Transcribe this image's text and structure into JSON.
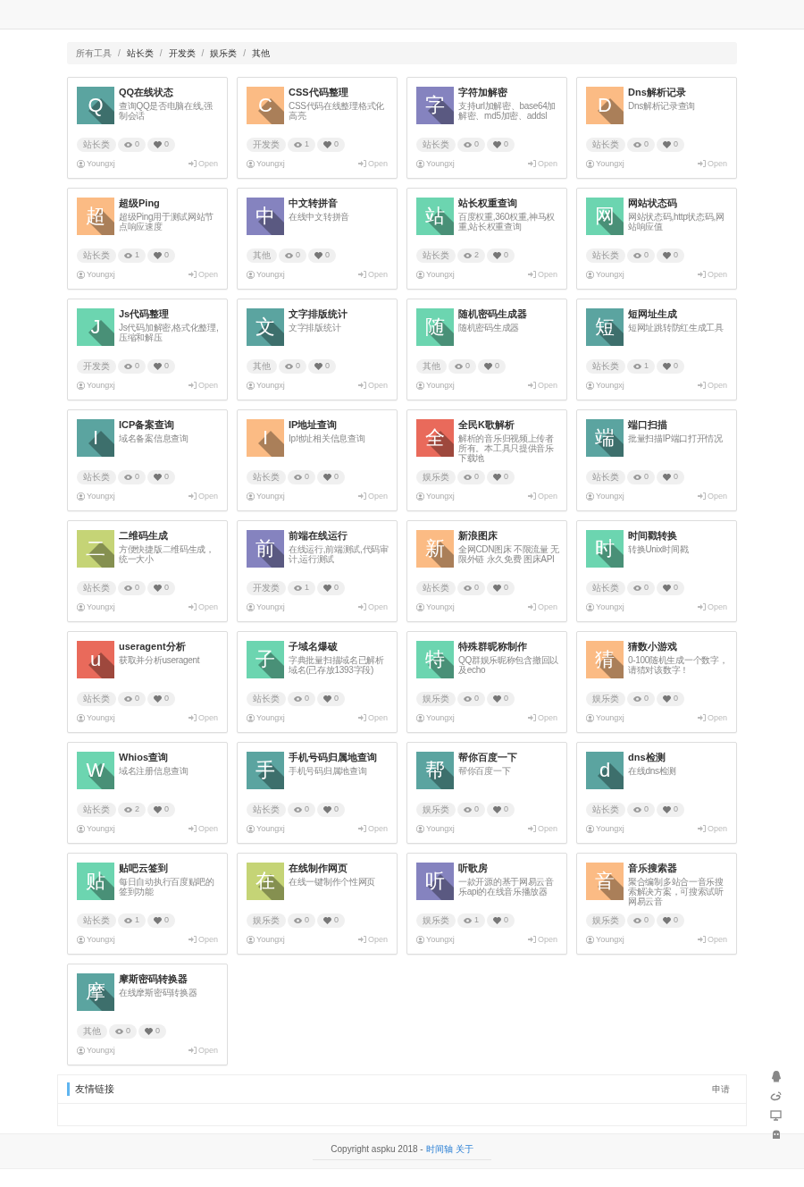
{
  "breadcrumb": [
    {
      "label": "所有工具",
      "selected": true
    },
    {
      "separator": "/",
      "label": "站长类",
      "selected": false
    },
    {
      "separator": "/",
      "label": "开发类",
      "selected": false
    },
    {
      "separator": "/",
      "label": "娱乐类",
      "selected": false
    },
    {
      "separator": "/",
      "label": "其他",
      "selected": false
    }
  ],
  "tools": [
    {
      "letter": "Q",
      "color": "#5ba4a0",
      "title": "QQ在线状态",
      "description": "查询QQ是否电脑在线,强制会话",
      "category": "站长类",
      "views": "0",
      "likes": "0",
      "author": "Youngxj",
      "action": "Open"
    },
    {
      "letter": "C",
      "color": "#fbbb84",
      "title": "CSS代码整理",
      "description": "CSS代码在线整理格式化高亮",
      "category": "开发类",
      "views": "1",
      "likes": "0",
      "author": "Youngxj",
      "action": "Open"
    },
    {
      "letter": "字",
      "color": "#8583bf",
      "title": "字符加解密",
      "description": "支持url加解密、base64加解密、md5加密、addsl",
      "category": "站长类",
      "views": "0",
      "likes": "0",
      "author": "Youngxj",
      "action": "Open"
    },
    {
      "letter": "D",
      "color": "#fbbb84",
      "title": "Dns解析记录",
      "description": "Dns解析记录查询",
      "category": "站长类",
      "views": "0",
      "likes": "0",
      "author": "Youngxj",
      "action": "Open"
    },
    {
      "letter": "超",
      "color": "#fbbb84",
      "title": "超级Ping",
      "description": "超级Ping用于测试网站节点响应速度",
      "category": "站长类",
      "views": "1",
      "likes": "0",
      "author": "Youngxj",
      "action": "Open"
    },
    {
      "letter": "中",
      "color": "#8583bf",
      "title": "中文转拼音",
      "description": "在线中文转拼音",
      "category": "其他",
      "views": "0",
      "likes": "0",
      "author": "Youngxj",
      "action": "Open"
    },
    {
      "letter": "站",
      "color": "#6cd5b0",
      "title": "站长权重查询",
      "description": "百度权重,360权重,神马权重,站长权重查询",
      "category": "站长类",
      "views": "2",
      "likes": "0",
      "author": "Youngxj",
      "action": "Open"
    },
    {
      "letter": "网",
      "color": "#6cd5b0",
      "title": "网站状态码",
      "description": "网站状态码,http状态码,网站响应值",
      "category": "站长类",
      "views": "0",
      "likes": "0",
      "author": "Youngxj",
      "action": "Open"
    },
    {
      "letter": "J",
      "color": "#6cd5b0",
      "title": "Js代码整理",
      "description": "Js代码加解密,格式化整理,压缩和解压",
      "category": "开发类",
      "views": "0",
      "likes": "0",
      "author": "Youngxj",
      "action": "Open"
    },
    {
      "letter": "文",
      "color": "#5ba4a0",
      "title": "文字排版统计",
      "description": "文字排版统计",
      "category": "其他",
      "views": "0",
      "likes": "0",
      "author": "Youngxj",
      "action": "Open"
    },
    {
      "letter": "随",
      "color": "#6cd5b0",
      "title": "随机密码生成器",
      "description": "随机密码生成器",
      "category": "其他",
      "views": "0",
      "likes": "0",
      "author": "Youngxj",
      "action": "Open"
    },
    {
      "letter": "短",
      "color": "#5ba4a0",
      "title": "短网址生成",
      "description": "短网址跳转防红生成工具",
      "category": "站长类",
      "views": "1",
      "likes": "0",
      "author": "Youngxj",
      "action": "Open"
    },
    {
      "letter": "I",
      "color": "#5ba4a0",
      "title": "ICP备案查询",
      "description": "域名备案信息查询",
      "category": "站长类",
      "views": "0",
      "likes": "0",
      "author": "Youngxj",
      "action": "Open"
    },
    {
      "letter": "I",
      "color": "#fbbb84",
      "title": "IP地址查询",
      "description": "Ip地址相关信息查询",
      "category": "站长类",
      "views": "0",
      "likes": "0",
      "author": "Youngxj",
      "action": "Open"
    },
    {
      "letter": "全",
      "color": "#e96a5b",
      "title": "全民K歌解析",
      "description": "解析的音乐归视频上传者所有。本工具只提供音乐下载地",
      "category": "娱乐类",
      "views": "0",
      "likes": "0",
      "author": "Youngxj",
      "action": "Open"
    },
    {
      "letter": "端",
      "color": "#5ba4a0",
      "title": "端口扫描",
      "description": "批量扫描IP端口打开情况",
      "category": "站长类",
      "views": "0",
      "likes": "0",
      "author": "Youngxj",
      "action": "Open"
    },
    {
      "letter": "二",
      "color": "#c5d476",
      "title": "二维码生成",
      "description": "方便快捷版二维码生成，统一大小",
      "category": "站长类",
      "views": "0",
      "likes": "0",
      "author": "Youngxj",
      "action": "Open"
    },
    {
      "letter": "前",
      "color": "#8583bf",
      "title": "前端在线运行",
      "description": "在线运行,前端测试,代码审计,运行测试",
      "category": "开发类",
      "views": "1",
      "likes": "0",
      "author": "Youngxj",
      "action": "Open"
    },
    {
      "letter": "新",
      "color": "#fbbb84",
      "title": "新浪图床",
      "description": "全网CDN图床 不限流量 无限外链 永久免费 图床API",
      "category": "站长类",
      "views": "0",
      "likes": "0",
      "author": "Youngxj",
      "action": "Open"
    },
    {
      "letter": "时",
      "color": "#6cd5b0",
      "title": "时间戳转换",
      "description": "转换Unix时间戳",
      "category": "站长类",
      "views": "0",
      "likes": "0",
      "author": "Youngxj",
      "action": "Open"
    },
    {
      "letter": "u",
      "color": "#e96a5b",
      "title": "useragent分析",
      "description": "获取并分析useragent",
      "category": "站长类",
      "views": "0",
      "likes": "0",
      "author": "Youngxj",
      "action": "Open"
    },
    {
      "letter": "子",
      "color": "#6cd5b0",
      "title": "子域名爆破",
      "description": "字典批量扫描域名已解析域名(已存放1393字段)",
      "category": "站长类",
      "views": "0",
      "likes": "0",
      "author": "Youngxj",
      "action": "Open"
    },
    {
      "letter": "特",
      "color": "#6cd5b0",
      "title": "特殊群昵称制作",
      "description": "QQ群娱乐昵称包含撤回以及echo",
      "category": "娱乐类",
      "views": "0",
      "likes": "0",
      "author": "Youngxj",
      "action": "Open"
    },
    {
      "letter": "猜",
      "color": "#fbbb84",
      "title": "猜数小游戏",
      "description": "0-100随机生成一个数字，请猜对该数字！",
      "category": "娱乐类",
      "views": "0",
      "likes": "0",
      "author": "Youngxj",
      "action": "Open"
    },
    {
      "letter": "W",
      "color": "#6cd5b0",
      "title": "Whios查询",
      "description": "域名注册信息查询",
      "category": "站长类",
      "views": "2",
      "likes": "0",
      "author": "Youngxj",
      "action": "Open"
    },
    {
      "letter": "手",
      "color": "#5ba4a0",
      "title": "手机号码归属地查询",
      "description": "手机号码归属地查询",
      "category": "站长类",
      "views": "0",
      "likes": "0",
      "author": "Youngxj",
      "action": "Open"
    },
    {
      "letter": "帮",
      "color": "#5ba4a0",
      "title": "帮你百度一下",
      "description": "帮你百度一下",
      "category": "娱乐类",
      "views": "0",
      "likes": "0",
      "author": "Youngxj",
      "action": "Open"
    },
    {
      "letter": "d",
      "color": "#5ba4a0",
      "title": "dns检测",
      "description": "在线dns检测",
      "category": "站长类",
      "views": "0",
      "likes": "0",
      "author": "Youngxj",
      "action": "Open"
    },
    {
      "letter": "贴",
      "color": "#6cd5b0",
      "title": "贴吧云签到",
      "description": "每日自动执行百度贴吧的签到功能",
      "category": "站长类",
      "views": "1",
      "likes": "0",
      "author": "Youngxj",
      "action": "Open"
    },
    {
      "letter": "在",
      "color": "#c5d476",
      "title": "在线制作网页",
      "description": "在线一键制作个性网页",
      "category": "娱乐类",
      "views": "0",
      "likes": "0",
      "author": "Youngxj",
      "action": "Open"
    },
    {
      "letter": "听",
      "color": "#8583bf",
      "title": "听歌房",
      "description": "一款开源的基于网易云音乐api的在线音乐播放器",
      "category": "娱乐类",
      "views": "1",
      "likes": "0",
      "author": "Youngxj",
      "action": "Open"
    },
    {
      "letter": "音",
      "color": "#fbbb84",
      "title": "音乐搜索器",
      "description": "聚合编制多站合一音乐搜索解决方案，可搜索试听网易云音",
      "category": "娱乐类",
      "views": "0",
      "likes": "0",
      "author": "Youngxj",
      "action": "Open"
    },
    {
      "letter": "摩",
      "color": "#5ba4a0",
      "title": "摩斯密码转换器",
      "description": "在线摩斯密码转换器",
      "category": "其他",
      "views": "0",
      "likes": "0",
      "author": "Youngxj",
      "action": "Open"
    }
  ],
  "links_panel": {
    "title": "友情链接",
    "action": "申请"
  },
  "footer": {
    "text": "Copyright aspku 2018 -",
    "links": [
      "时间轴",
      "关于"
    ]
  }
}
